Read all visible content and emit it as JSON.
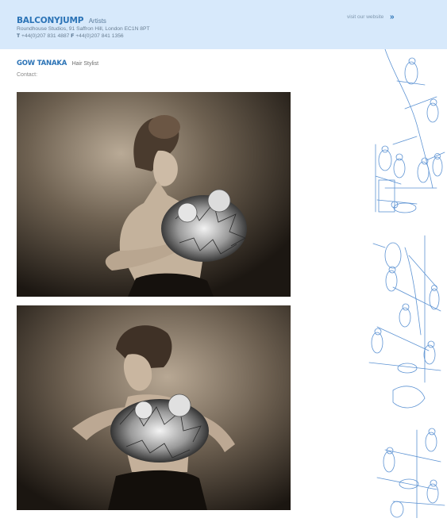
{
  "header": {
    "brand_name": "BALCONYJUMP",
    "brand_tag": "Artists",
    "address": "Roundhouse Studios, 91 Saffron Hill, London EC1N 8PT",
    "phone_t_label": "T",
    "phone_t": "+44(0)207 831 4887",
    "phone_f_label": "F",
    "phone_f": "+44(0)207 841 1356",
    "visit_link": "visit our website",
    "visit_icon": "»"
  },
  "artist": {
    "name": "GOW TANAKA",
    "role": "Hair Stylist",
    "contact_label": "Contact:"
  },
  "colors": {
    "header_bg": "#d7e9fb",
    "brand_blue": "#2b73b6",
    "illustration_blue": "#5d93d3"
  },
  "icons": {
    "visit": "double-chevron-right-icon",
    "decoration": "bird-branch-illustration"
  }
}
